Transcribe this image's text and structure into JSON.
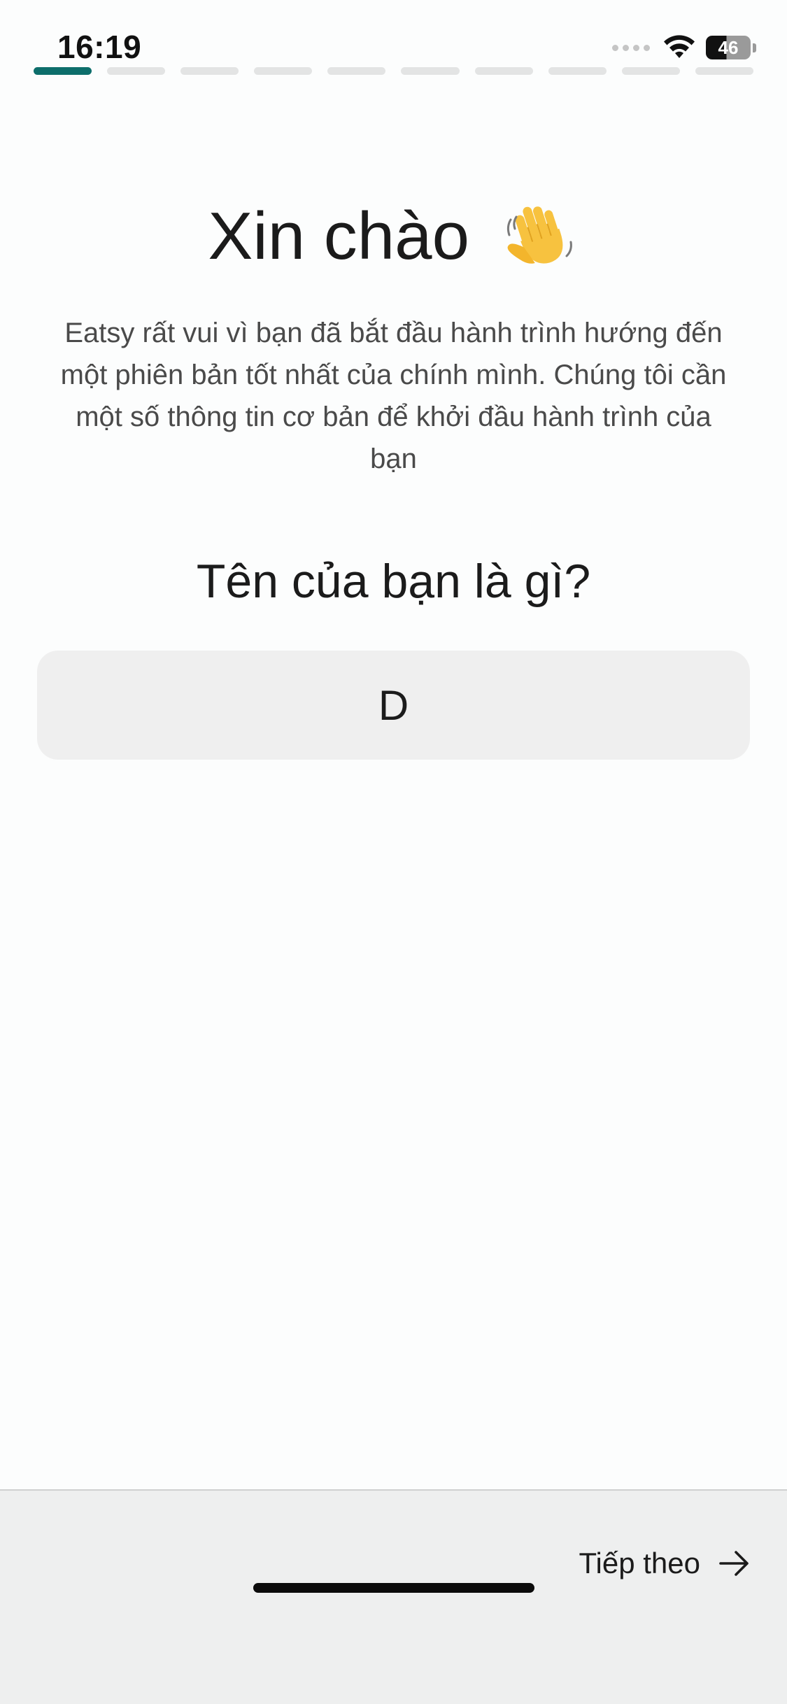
{
  "status_bar": {
    "time": "16:19",
    "battery_level": "46"
  },
  "progress": {
    "total_steps": 10,
    "current_step": 1
  },
  "greeting": {
    "title": "Xin chào",
    "icon": "waving-hand-icon"
  },
  "intro_text": "Eatsy rất vui vì bạn đã bắt đầu hành trình hướng đến một phiên bản tốt nhất của chính mình. Chúng tôi cần một số thông tin cơ bản để khởi đầu hành trình của bạn",
  "question": "Tên của bạn là gì?",
  "name_field": {
    "value": "D"
  },
  "footer": {
    "next_label": "Tiếp theo",
    "next_icon": "arrow-right-icon"
  },
  "colors": {
    "progress_active": "#0d6e6b",
    "progress_inactive": "#e3e4e4",
    "background": "#fcfdfd",
    "input_background": "#efefef",
    "footer_background": "#eeefef"
  }
}
